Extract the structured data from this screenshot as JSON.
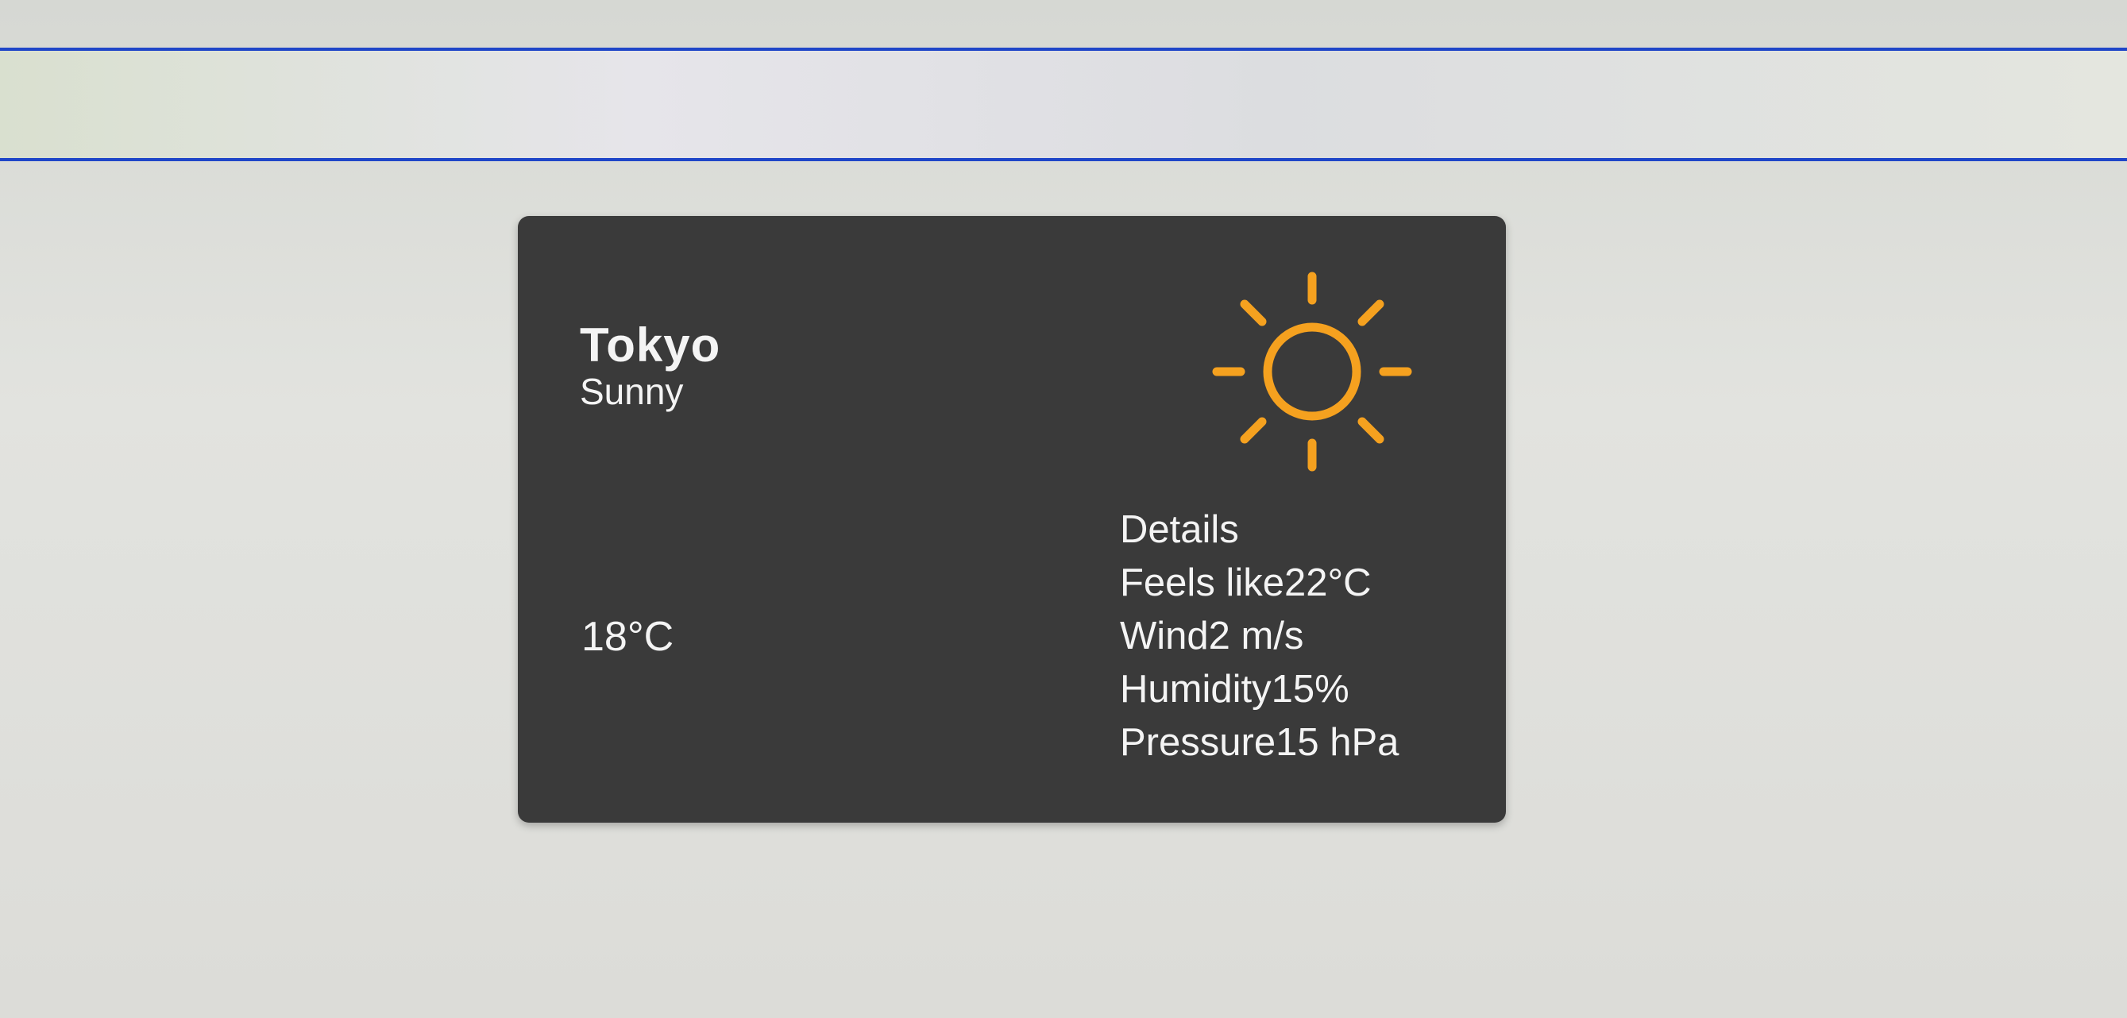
{
  "colors": {
    "card_background": "#3a3a3a",
    "text": "#f4f4f4",
    "sun": "#f5a11f",
    "screen_band": "#1f46c8"
  },
  "weather": {
    "city": "Tokyo",
    "condition": "Sunny",
    "temperature": "18°C",
    "icon": "sun-icon",
    "details": {
      "heading": "Details",
      "rows": [
        {
          "label": "Feels like",
          "value": "22°C"
        },
        {
          "label": "Wind",
          "value": "2 m/s"
        },
        {
          "label": "Humidity",
          "value": "15%"
        },
        {
          "label": "Pressure",
          "value": "15 hPa"
        }
      ]
    }
  }
}
